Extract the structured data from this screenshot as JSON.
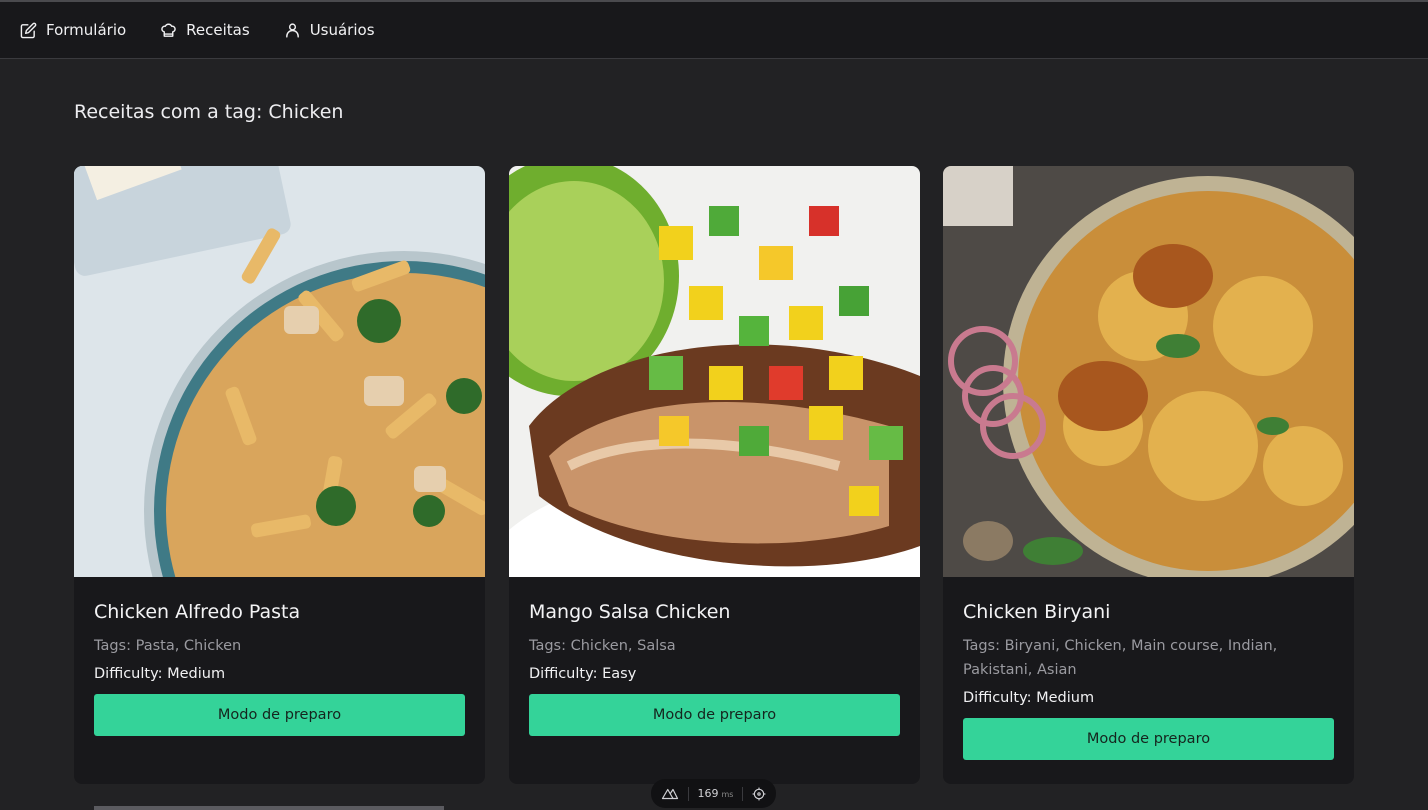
{
  "nav": {
    "items": [
      {
        "label": "Formulário",
        "icon": "edit-icon"
      },
      {
        "label": "Receitas",
        "icon": "chef-hat-icon"
      },
      {
        "label": "Usuários",
        "icon": "user-icon"
      }
    ]
  },
  "page": {
    "title": "Receitas com a tag: Chicken"
  },
  "recipes": [
    {
      "title": "Chicken Alfredo Pasta",
      "tags": "Tags: Pasta, Chicken",
      "difficulty": "Difficulty: Medium",
      "button": "Modo de preparo",
      "image": "chicken-alfredo-pasta-photo"
    },
    {
      "title": "Mango Salsa Chicken",
      "tags": "Tags: Chicken, Salsa",
      "difficulty": "Difficulty: Easy",
      "button": "Modo de preparo",
      "image": "mango-salsa-chicken-photo"
    },
    {
      "title": "Chicken Biryani",
      "tags": "Tags: Biryani, Chicken, Main course, Indian, Pakistani, Asian",
      "difficulty": "Difficulty: Medium",
      "button": "Modo de preparo",
      "image": "chicken-biryani-photo"
    }
  ],
  "devtools": {
    "time": "169",
    "unit": "ms",
    "icon": "nuxt-icon"
  },
  "colors": {
    "accent": "#34d399",
    "background": "#222224",
    "card": "#18181b"
  }
}
